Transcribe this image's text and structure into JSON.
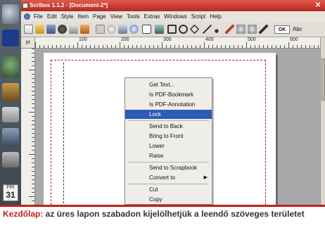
{
  "window": {
    "title": "Scribus 1.1.2 - [Document-2*]",
    "close_glyph": "✕"
  },
  "menubar": {
    "items": [
      "File",
      "Edit",
      "Style",
      "Item",
      "Page",
      "View",
      "Tools",
      "Extras",
      "Windows",
      "Script",
      "Help"
    ]
  },
  "toolbar": {
    "zoom_label": "OK",
    "font_label": "Abc"
  },
  "ruler": {
    "unit": "pt",
    "labels": [
      "100",
      "200",
      "300",
      "400",
      "500",
      "600"
    ]
  },
  "context_menu": {
    "items": [
      {
        "label": "Get Text...",
        "highlighted": false
      },
      {
        "label": "Is PDF-Bookmark",
        "highlighted": false
      },
      {
        "label": "Is PDF-Annotation",
        "highlighted": false
      },
      {
        "label": "Lock",
        "highlighted": true
      },
      {
        "label": "Send to Back",
        "highlighted": false
      },
      {
        "label": "Bring to Front",
        "highlighted": false
      },
      {
        "label": "Lower",
        "highlighted": false
      },
      {
        "label": "Raise",
        "highlighted": false
      },
      {
        "label": "Send to Scrapbook",
        "highlighted": false
      },
      {
        "label": "Convert to",
        "highlighted": false,
        "submenu": true
      },
      {
        "label": "Cut",
        "highlighted": false
      },
      {
        "label": "Copy",
        "highlighted": false
      }
    ],
    "submenu_arrow": "▶"
  },
  "calendar": {
    "day_name": "FRI",
    "day": "31",
    "month": "OCT"
  },
  "caption": {
    "lead": "Kezdőlap:",
    "text": " az üres lapon szabadon kijelölhetjük a leendő szöveges területet"
  },
  "colors": {
    "accent": "#c21e1e",
    "highlight": "#2c5bb8",
    "titlebar": "#c8382a"
  }
}
